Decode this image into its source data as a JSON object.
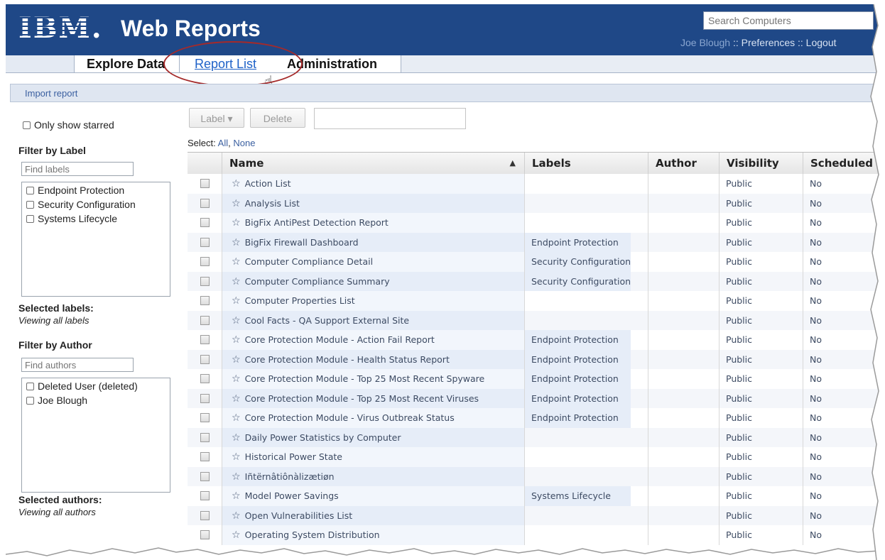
{
  "header": {
    "logo": "IBM.",
    "title": "Web Reports",
    "search_placeholder": "Search Computers",
    "user": "Joe Blough",
    "links_sep": " :: ",
    "preferences": "Preferences",
    "logout": "Logout",
    "colors": {
      "header_bg": "#1f4887",
      "link": "#8aa6d0"
    }
  },
  "tabs": [
    {
      "label": "Explore Data",
      "active": false
    },
    {
      "label": "Report List",
      "active": true
    },
    {
      "label": "Administration",
      "active": false
    }
  ],
  "actionbar": {
    "import_label": "Import report"
  },
  "sidebar": {
    "only_starred": "Only show starred",
    "filter_label_title": "Filter by Label",
    "find_labels_placeholder": "Find labels",
    "labels": [
      "Endpoint Protection",
      "Security Configuration",
      "Systems Lifecycle"
    ],
    "selected_labels_title": "Selected labels:",
    "selected_labels_value": "Viewing all labels",
    "filter_author_title": "Filter by Author",
    "find_authors_placeholder": "Find authors",
    "authors": [
      "Deleted User (deleted)",
      "Joe Blough"
    ],
    "selected_authors_title": "Selected authors:",
    "selected_authors_value": "Viewing all authors"
  },
  "toolbar": {
    "label_button": "Label ▾",
    "delete_button": "Delete",
    "select_prefix": "Select:",
    "select_all": "All",
    "select_none": "None"
  },
  "table": {
    "columns": [
      "Name",
      "Labels",
      "Author",
      "Visibility",
      "Scheduled"
    ],
    "rows": [
      {
        "name": "Action List",
        "labels": "",
        "author": "",
        "visibility": "Public",
        "scheduled": "No"
      },
      {
        "name": "Analysis List",
        "labels": "",
        "author": "",
        "visibility": "Public",
        "scheduled": "No"
      },
      {
        "name": "BigFix AntiPest Detection Report",
        "labels": "",
        "author": "",
        "visibility": "Public",
        "scheduled": "No"
      },
      {
        "name": "BigFix Firewall Dashboard",
        "labels": "Endpoint Protection",
        "author": "",
        "visibility": "Public",
        "scheduled": "No"
      },
      {
        "name": "Computer Compliance Detail",
        "labels": "Security Configuration",
        "author": "",
        "visibility": "Public",
        "scheduled": "No"
      },
      {
        "name": "Computer Compliance Summary",
        "labels": "Security Configuration",
        "author": "",
        "visibility": "Public",
        "scheduled": "No"
      },
      {
        "name": "Computer Properties List",
        "labels": "",
        "author": "",
        "visibility": "Public",
        "scheduled": "No"
      },
      {
        "name": "Cool Facts - QA Support External Site",
        "labels": "",
        "author": "",
        "visibility": "Public",
        "scheduled": "No"
      },
      {
        "name": "Core Protection Module - Action Fail Report",
        "labels": "Endpoint Protection",
        "author": "",
        "visibility": "Public",
        "scheduled": "No"
      },
      {
        "name": "Core Protection Module - Health Status Report",
        "labels": "Endpoint Protection",
        "author": "",
        "visibility": "Public",
        "scheduled": "No"
      },
      {
        "name": "Core Protection Module - Top 25 Most Recent Spyware",
        "labels": "Endpoint Protection",
        "author": "",
        "visibility": "Public",
        "scheduled": "No"
      },
      {
        "name": "Core Protection Module - Top 25 Most Recent Viruses",
        "labels": "Endpoint Protection",
        "author": "",
        "visibility": "Public",
        "scheduled": "No"
      },
      {
        "name": "Core Protection Module - Virus Outbreak Status",
        "labels": "Endpoint Protection",
        "author": "",
        "visibility": "Public",
        "scheduled": "No"
      },
      {
        "name": "Daily Power Statistics by Computer",
        "labels": "",
        "author": "",
        "visibility": "Public",
        "scheduled": "No"
      },
      {
        "name": "Historical Power State",
        "labels": "",
        "author": "",
        "visibility": "Public",
        "scheduled": "No"
      },
      {
        "name": "Iñtërnâtiônàlizætiøn",
        "labels": "",
        "author": "",
        "visibility": "Public",
        "scheduled": "No"
      },
      {
        "name": "Model Power Savings",
        "labels": "Systems Lifecycle",
        "author": "",
        "visibility": "Public",
        "scheduled": "No"
      },
      {
        "name": "Open Vulnerabilities List",
        "labels": "",
        "author": "",
        "visibility": "Public",
        "scheduled": "No"
      },
      {
        "name": "Operating System Distribution",
        "labels": "",
        "author": "",
        "visibility": "Public",
        "scheduled": "No"
      }
    ]
  }
}
